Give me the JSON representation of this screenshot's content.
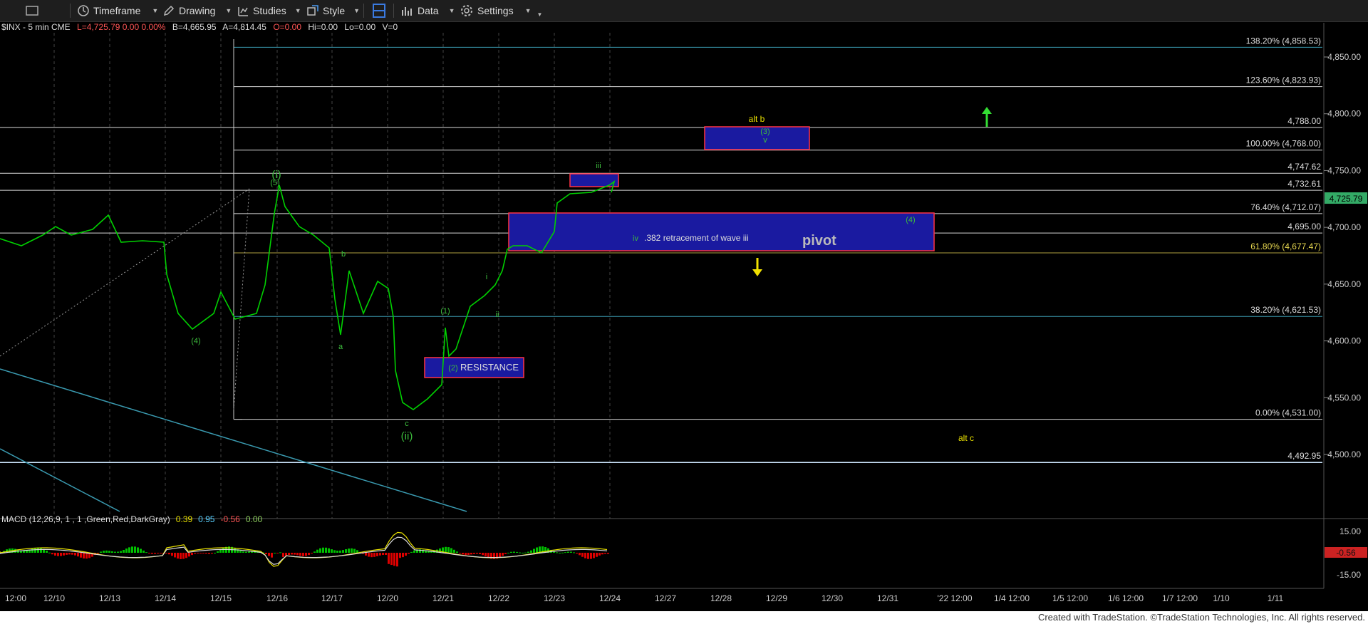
{
  "toolbar": {
    "timeframe": "Timeframe",
    "drawing": "Drawing",
    "studies": "Studies",
    "style": "Style",
    "data": "Data",
    "settings": "Settings"
  },
  "symbol_bar": {
    "symbol": "$INX - 5 min  CME",
    "last": "L=4,725.79  0.00  0.00%",
    "bid": "B=4,665.95",
    "ask": "A=4,814.45",
    "open": "O=0.00",
    "hi": "Hi=0.00",
    "lo": "Lo=0.00",
    "vol": "V=0"
  },
  "colors": {
    "bg": "#000000",
    "price_line": "#00d000",
    "label_green": "#3dbd3d",
    "label_yellow": "#e8e000",
    "box_fill": "#1a1aa0",
    "box_border": "#ff3344",
    "grid": "#2a2a2a",
    "fib_line": "#d8d8d8",
    "trend_line": "#3a9ab0",
    "last_price_tag": "#33aa66",
    "macd_up": "#00c000",
    "macd_down": "#dd0000"
  },
  "icons": [
    "window-icon",
    "timeframe-clock-icon",
    "drawing-pencil-icon",
    "studies-icon",
    "style-icon",
    "layout-icon",
    "data-bars-icon",
    "settings-gear-icon"
  ],
  "chart_data": {
    "type": "line",
    "symbol": "$INX",
    "interval": "5 min",
    "x_ticks": [
      "12:00",
      "12/10",
      "12/13",
      "12/14",
      "12/15",
      "12/16",
      "12/17",
      "12/20",
      "12/21",
      "12/22",
      "12/23",
      "12/24",
      "12/27",
      "12/28",
      "12/29",
      "12/30",
      "12/31",
      "'22 12:00",
      "1/4 12:00",
      "1/5 12:00",
      "1/6 12:00",
      "1/7 12:00",
      "1/10",
      "1/11"
    ],
    "y_ticks": [
      "4,850.00",
      "4,800.00",
      "4,750.00",
      "4,700.00",
      "4,650.00",
      "4,600.00",
      "4,550.00",
      "4,500.00"
    ],
    "ylim": [
      4460,
      4880
    ],
    "last_price": "4,725.79",
    "series": [
      {
        "x": [
          "12/9",
          "12/10",
          "12/13",
          "12/14",
          "12/14",
          "12/15",
          "12/15",
          "12/16",
          "12/16",
          "12/17",
          "12/17",
          "12/17",
          "12/20",
          "12/20",
          "12/21",
          "12/21",
          "12/21",
          "12/22",
          "12/22",
          "12/23",
          "12/23",
          "12/23"
        ],
        "values": [
          4700,
          4692,
          4718,
          4690,
          4608,
          4645,
          4618,
          4730,
          4702,
          4600,
          4660,
          4645,
          4575,
          4532,
          4568,
          4610,
          4585,
          4675,
          4680,
          4730,
          4735,
          4725.79
        ]
      }
    ],
    "fib_levels": [
      {
        "label": "138.20% (4,858.53)",
        "value": 4858.53
      },
      {
        "label": "123.60% (4,823.93)",
        "value": 4823.93
      },
      {
        "label": "4,788.00",
        "value": 4788.0
      },
      {
        "label": "100.00% (4,768.00)",
        "value": 4768.0
      },
      {
        "label": "4,747.62",
        "value": 4747.62
      },
      {
        "label": "4,732.61",
        "value": 4732.61
      },
      {
        "label": "76.40% (4,712.07)",
        "value": 4712.07
      },
      {
        "label": "4,695.00",
        "value": 4695.0
      },
      {
        "label": "61.80% (4,677.47)",
        "value": 4677.47
      },
      {
        "label": "38.20% (4,621.53)",
        "value": 4621.53
      },
      {
        "label": "0.00% (4,531.00)",
        "value": 4531.0
      },
      {
        "label": "4,492.95",
        "value": 4492.95
      }
    ],
    "annotations": [
      {
        "text": "(i)",
        "x": "12/16",
        "y": 4748,
        "color": "green"
      },
      {
        "text": "(5)",
        "x": "12/16",
        "y": 4738,
        "color": "green"
      },
      {
        "text": "(4)",
        "x": "12/14",
        "y": 4595,
        "color": "green"
      },
      {
        "text": "b",
        "x": "12/17",
        "y": 4668,
        "color": "green"
      },
      {
        "text": "a",
        "x": "12/17",
        "y": 4590,
        "color": "green"
      },
      {
        "text": "c",
        "x": "12/20",
        "y": 4522,
        "color": "green"
      },
      {
        "text": "(ii)",
        "x": "12/20",
        "y": 4508,
        "color": "green"
      },
      {
        "text": "(1)",
        "x": "12/21",
        "y": 4632,
        "color": "green"
      },
      {
        "text": "(2)",
        "x": "12/21",
        "y": 4576,
        "color": "green"
      },
      {
        "text": "i",
        "x": "12/21",
        "y": 4652,
        "color": "green"
      },
      {
        "text": "ii",
        "x": "12/22",
        "y": 4630,
        "color": "green"
      },
      {
        "text": "iii",
        "x": "12/23",
        "y": 4753,
        "color": "green"
      },
      {
        "text": "iv",
        "x": "12/23",
        "y": 4702,
        "color": "green"
      },
      {
        "text": "(3)",
        "x": "12/28",
        "y": 4783,
        "color": "green"
      },
      {
        "text": "v",
        "x": "12/28",
        "y": 4774,
        "color": "green"
      },
      {
        "text": "(4)",
        "x": "12/31",
        "y": 4705,
        "color": "green"
      },
      {
        "text": "alt b",
        "x": "12/28",
        "y": 4794,
        "color": "yellow"
      },
      {
        "text": "alt c",
        "x": "'22 12:00",
        "y": 4515,
        "color": "yellow"
      }
    ],
    "boxes": [
      {
        "label": "RESISTANCE",
        "from": "12/20",
        "to": "12/21",
        "top": 4588,
        "bottom": 4570
      },
      {
        "label": "",
        "from": "12/23",
        "to": "12/24",
        "top": 4750,
        "bottom": 4738
      },
      {
        "label": "",
        "from": "12/27",
        "to": "12/29",
        "top": 4788,
        "bottom": 4768
      },
      {
        "label": "pivot",
        "sublabel": ".382 retracement of wave iii",
        "from": "12/22",
        "to": "12/31",
        "top": 4712,
        "bottom": 4677
      }
    ],
    "arrows": [
      {
        "dir": "up",
        "color": "green",
        "x": "1/4 12:00",
        "y": 4790
      },
      {
        "dir": "down",
        "color": "yellow",
        "x": "12/28",
        "y": 4660
      }
    ],
    "indicator": {
      "name": "MACD (12,26,9, 1 , 1 ,Green,Red,DarkGray)",
      "values": [
        "0.39",
        "0.95",
        "-0.56",
        "0.00"
      ],
      "y_ticks": [
        "15.00",
        "-15.00"
      ],
      "current": "-0.56"
    }
  },
  "footer": {
    "credit": "Created with TradeStation. ©TradeStation Technologies, Inc. All rights reserved."
  }
}
